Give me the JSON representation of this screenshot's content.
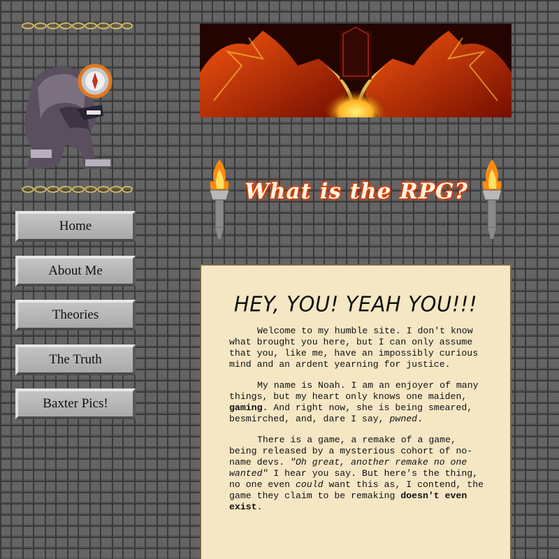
{
  "nav": {
    "items": [
      {
        "label": "Home"
      },
      {
        "label": "About Me"
      },
      {
        "label": "Theories"
      },
      {
        "label": "The Truth"
      },
      {
        "label": "Baxter Pics!"
      }
    ]
  },
  "heading": {
    "title": "What is the RPG?"
  },
  "article": {
    "headline": "HEY, YOU! YEAH YOU!!!",
    "p1": "Welcome to my humble site. I don't know what brought you here, but I can only assume that you, like me, have an impossibly curious mind and an ardent yearning for justice.",
    "p2": {
      "a": "My name is Noah. I am an enjoyer of many things, but my heart only knows one maiden, ",
      "b": "gaming",
      "c": ". And right now, she is being smeared, besmirched, and, dare I say, ",
      "d": "pwned",
      "e": "."
    },
    "p3": {
      "a": "There is a game, a remake of a game, being released by a mysterious cohort of no-name devs. ",
      "b": "\"Oh great, another remake no one wanted\"",
      "c": " I hear you say. But here's the thing, no one even ",
      "d": "could",
      "e": " want this as, I contend, the game they claim to be remaking ",
      "f": "doesn't even exist",
      "g": "."
    }
  },
  "icons": {
    "chain": "chain-divider-icon",
    "monster": "monster-icon",
    "torch": "torch-icon",
    "banner": "dragon-banner"
  },
  "colors": {
    "background": "#646464",
    "content_bg": "#f5e7c4",
    "button_bg": "#b8b8b8",
    "title_glow": "#ff5a00"
  }
}
